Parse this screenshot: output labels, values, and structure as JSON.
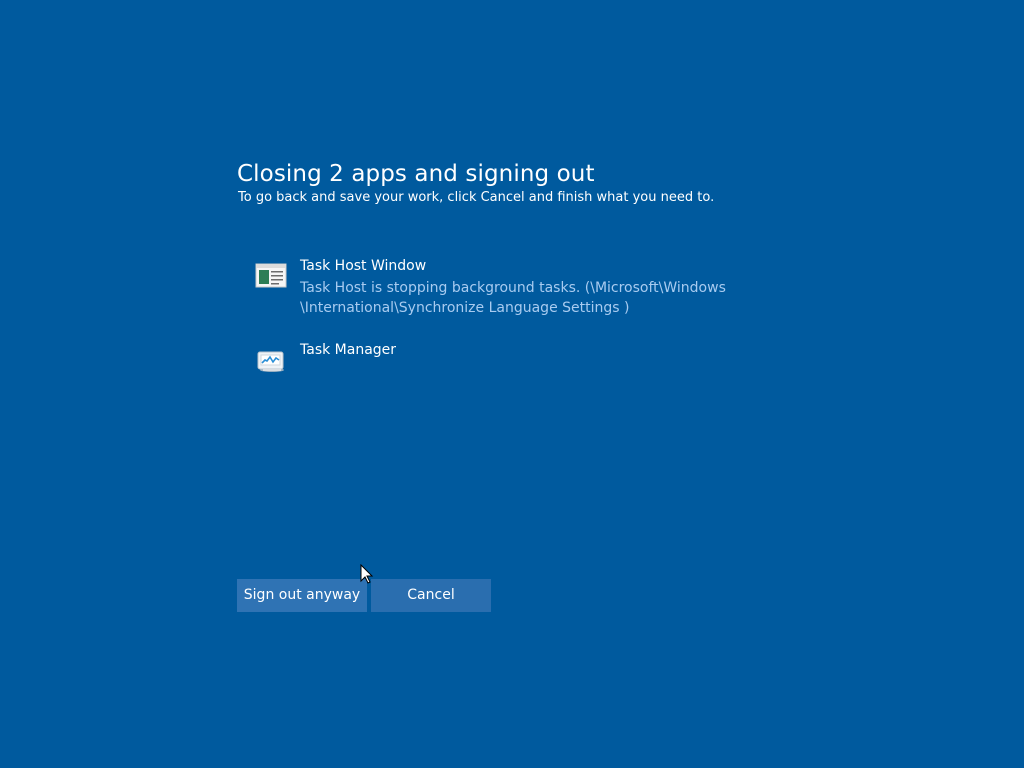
{
  "dialog": {
    "title": "Closing 2 apps and signing out",
    "subtitle": "To go back and save your work, click Cancel and finish what you need to."
  },
  "apps": [
    {
      "name": "Task Host Window",
      "status": "Task Host is stopping background tasks. (\\Microsoft\\Windows\n\\International\\Synchronize Language Settings )",
      "icon": "task-host-window-icon"
    },
    {
      "name": "Task Manager",
      "status": "",
      "icon": "task-manager-icon"
    }
  ],
  "buttons": {
    "sign_out_label": "Sign out anyway",
    "cancel_label": "Cancel"
  },
  "colors": {
    "background": "#005a9e",
    "button": "#2f73b4",
    "secondary_text": "#a8cbf0"
  },
  "icons": {
    "cursor": "mouse-cursor-icon"
  }
}
